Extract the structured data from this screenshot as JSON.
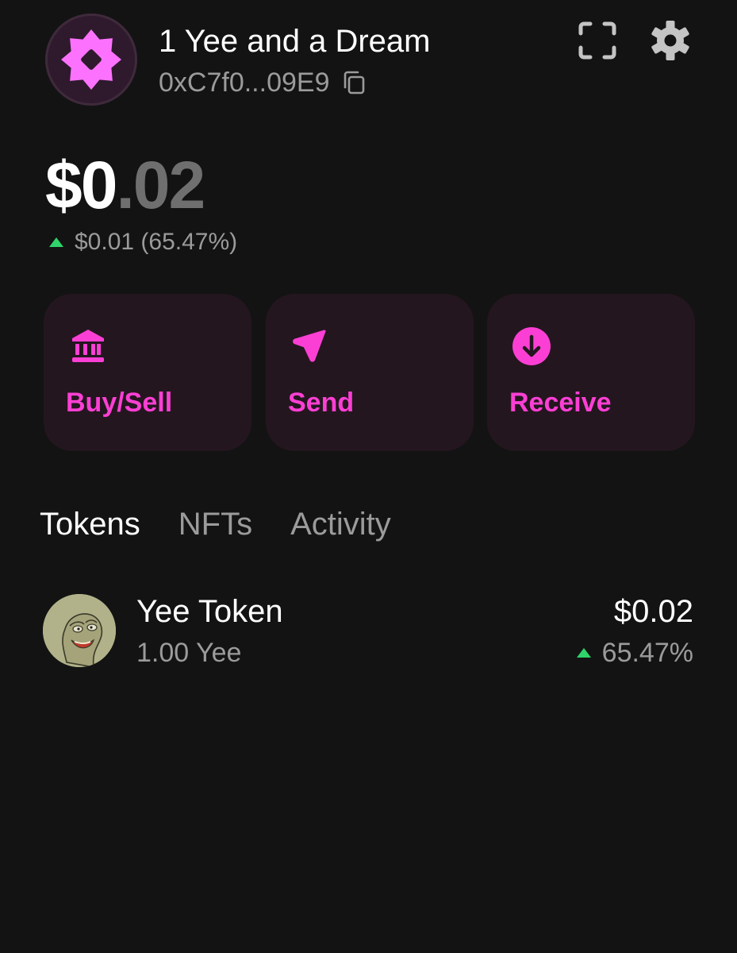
{
  "colors": {
    "background": "#131313",
    "accent": "#fc3fd4",
    "button_bg": "#24161f",
    "muted_text": "#9b9b9b",
    "positive": "#2fd46a"
  },
  "header": {
    "account_name": "1 Yee and a Dream",
    "address": "0xC7f0...09E9",
    "icons": [
      "account-avatar-icon",
      "copy-icon",
      "scan-icon",
      "gear-icon"
    ]
  },
  "balance": {
    "whole": "$0",
    "cents": ".02",
    "change_text": "$0.01 (65.47%)",
    "change_direction": "up"
  },
  "actions": {
    "buy_sell": {
      "label": "Buy/Sell",
      "icon": "bank-icon"
    },
    "send": {
      "label": "Send",
      "icon": "send-icon"
    },
    "receive": {
      "label": "Receive",
      "icon": "arrow-down-circle-icon"
    }
  },
  "tabs": [
    {
      "label": "Tokens",
      "active": true
    },
    {
      "label": "NFTs",
      "active": false
    },
    {
      "label": "Activity",
      "active": false
    }
  ],
  "tokens": [
    {
      "name": "Yee Token",
      "amount": "1.00 Yee",
      "value": "$0.02",
      "change": "65.47%",
      "change_direction": "up",
      "icon": "yee-token-logo"
    }
  ]
}
